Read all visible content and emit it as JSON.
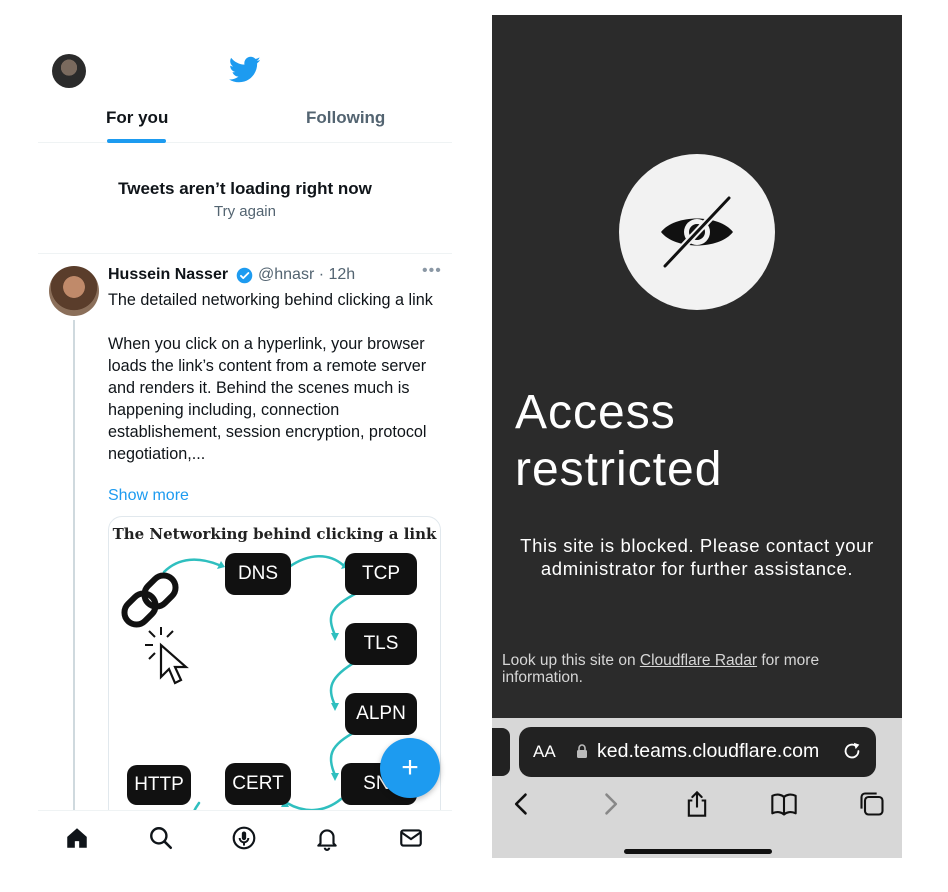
{
  "twitter": {
    "tabs": {
      "for_you": "For you",
      "following": "Following"
    },
    "error": {
      "title": "Tweets aren’t loading right now",
      "retry": "Try again"
    },
    "tweet": {
      "name": "Hussein Nasser",
      "handle": "@hnasr · 12h",
      "paragraph1": "The detailed networking behind clicking a link",
      "paragraph2": "When you click on a hyperlink, your browser loads the link’s content from a remote server and renders it. Behind the scenes much is happening including, connection establishement, session encryption, protocol negotiation,...",
      "show_more": "Show more",
      "card": {
        "title": "The Networking behind clicking a link",
        "nodes": {
          "dns": "DNS",
          "tcp": "TCP",
          "tls": "TLS",
          "alpn": "ALPN",
          "sni": "SNI",
          "http": "HTTP",
          "cert": "CERT"
        }
      }
    },
    "fab_label": "+",
    "accent_color": "#1d9bf0",
    "icons": [
      "home-icon",
      "search-icon",
      "spaces-icon",
      "notifications-icon",
      "messages-icon"
    ]
  },
  "cloudflare": {
    "title": "Access restricted",
    "message": "This site is blocked. Please contact your administrator for further assistance.",
    "lookup_prefix": "Look up this site on ",
    "lookup_link": "Cloudflare Radar",
    "lookup_suffix": " for more information.",
    "background_color": "#2b2b2b"
  },
  "safari": {
    "aa_label": "AA",
    "url": "ked.teams.cloudflare.com",
    "toolbar_icons": [
      "back-icon",
      "forward-icon",
      "share-icon",
      "bookmarks-icon",
      "tabs-icon"
    ]
  }
}
